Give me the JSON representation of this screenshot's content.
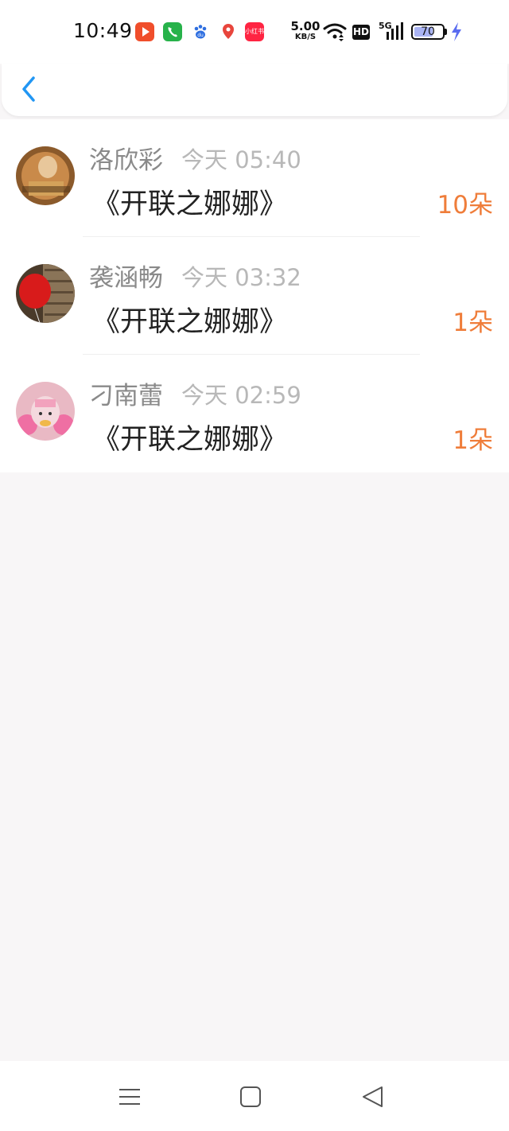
{
  "status_bar": {
    "time": "10:49",
    "app_icons": [
      {
        "name": "video-app-icon",
        "color": "#f04e2b"
      },
      {
        "name": "phone-icon",
        "color": "#27b24a"
      },
      {
        "name": "baidu-icon",
        "color": "#2f6fe0"
      },
      {
        "name": "location-app-icon",
        "color": "#e8453c"
      },
      {
        "name": "xiaohongshu-icon",
        "color": "#ff2442",
        "label": "小红书"
      }
    ],
    "net_speed": "5.00",
    "net_unit": "KB/S",
    "hd_label": "HD",
    "signal_label": "5G",
    "battery": "70",
    "battery_level": 0.7
  },
  "header": {
    "back_icon": "chevron-left-icon",
    "accent_color": "#2196f3"
  },
  "gifts": [
    {
      "name": "洛欣彩",
      "time": "今天 05:40",
      "title": "《开联之娜娜》",
      "count": "10朵"
    },
    {
      "name": "袭涵畅",
      "time": "今天 03:32",
      "title": "《开联之娜娜》",
      "count": "1朵"
    },
    {
      "name": "刁南蕾",
      "time": "今天 02:59",
      "title": "《开联之娜娜》",
      "count": "1朵"
    }
  ],
  "nav_bar": {
    "buttons": [
      "menu-icon",
      "home-icon",
      "back-triangle-icon"
    ]
  }
}
